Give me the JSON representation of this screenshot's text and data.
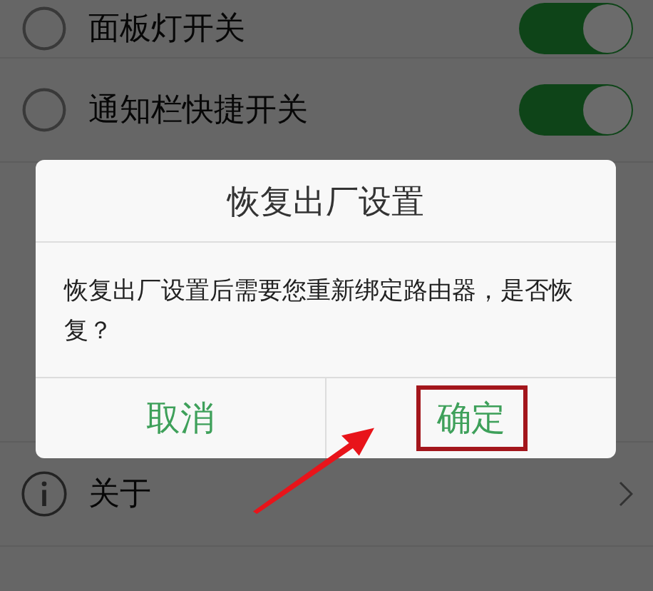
{
  "settings": [
    {
      "kind": "toggle",
      "label": "面板灯开关",
      "on": true
    },
    {
      "kind": "toggle",
      "label": "通知栏快捷开关",
      "on": true
    },
    {
      "kind": "link",
      "label": "关于"
    }
  ],
  "dialog": {
    "title": "恢复出厂设置",
    "message": "恢复出厂设置后需要您重新绑定路由器，是否恢复？",
    "buttons": [
      {
        "label": "取消",
        "highlighted": false
      },
      {
        "label": "确定",
        "highlighted": true
      }
    ]
  }
}
